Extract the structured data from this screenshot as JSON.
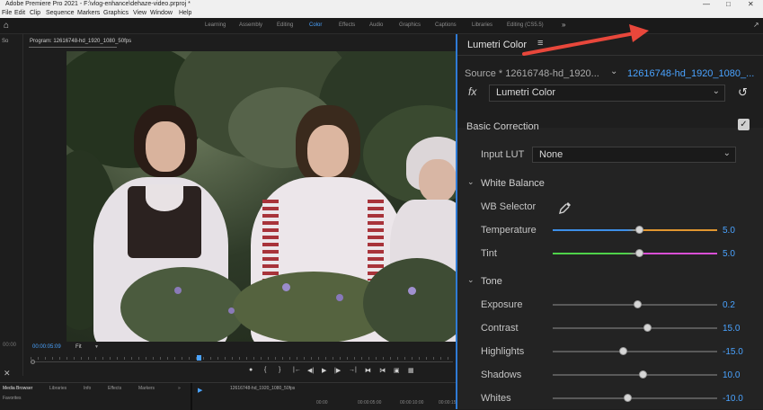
{
  "window": {
    "title": "Adobe Premiere Pro 2021 - F:\\vlog-enhance\\dehaze-video.prproj *",
    "controls": [
      "minimize",
      "maximize",
      "close"
    ]
  },
  "menu": [
    "File",
    "Edit",
    "Clip",
    "Sequence",
    "Markers",
    "Graphics",
    "View",
    "Window",
    "Help"
  ],
  "workspaces": [
    {
      "label": "Learning",
      "active": false
    },
    {
      "label": "Assembly",
      "active": false
    },
    {
      "label": "Editing",
      "active": false
    },
    {
      "label": "Color",
      "active": true
    },
    {
      "label": "Effects",
      "active": false
    },
    {
      "label": "Audio",
      "active": false
    },
    {
      "label": "Graphics",
      "active": false
    },
    {
      "label": "Captions",
      "active": false
    },
    {
      "label": "Libraries",
      "active": false
    },
    {
      "label": "Editing (CS5.5)",
      "active": false
    }
  ],
  "left_column": {
    "tab": "So",
    "timecode": "00:00",
    "wrench_glyph": "✕"
  },
  "program": {
    "title": "Program: 12616748-hd_1920_1080_50fps",
    "timecode": "00:00:05:09",
    "fit": "Fit",
    "transport": [
      "●",
      "{",
      "}",
      "|←",
      "◀|",
      "▶",
      "|▶",
      "→|",
      "⧓",
      "⧒",
      "▣",
      "▦"
    ]
  },
  "bottom": {
    "tabs": [
      {
        "label": "Media Browser",
        "active": true
      },
      {
        "label": "Libraries",
        "active": false
      },
      {
        "label": "Info",
        "active": false
      },
      {
        "label": "Effects",
        "active": false
      },
      {
        "label": "Markers",
        "active": false
      }
    ],
    "favorites": "Favorites",
    "sequence": "12616748-hd_1920_1080_50fps",
    "timecodes": [
      "00:00",
      "00:00:05:00",
      "00:00:10:00",
      "00:00:15:00"
    ],
    "more": "»"
  },
  "lumetri": {
    "title": "Lumetri Color",
    "menu_glyph": "≡",
    "source": "Source * 12616748-hd_1920...",
    "clip": "12616748-hd_1920_1080_...",
    "fx": "fx",
    "effect": "Lumetri Color",
    "basic_correction": "Basic Correction",
    "basic_correction_enabled": true,
    "input_lut_label": "Input LUT",
    "input_lut_value": "None",
    "white_balance": "White Balance",
    "wb_selector": "WB Selector",
    "tone": "Tone",
    "sliders": [
      {
        "label": "Temperature",
        "value": "5.0",
        "position": 0.53,
        "track": "temperature"
      },
      {
        "label": "Tint",
        "value": "5.0",
        "position": 0.53,
        "track": "tint"
      },
      {
        "label": "Exposure",
        "value": "0.2",
        "position": 0.52,
        "track": "gray"
      },
      {
        "label": "Contrast",
        "value": "15.0",
        "position": 0.58,
        "track": "gray"
      },
      {
        "label": "Highlights",
        "value": "-15.0",
        "position": 0.43,
        "track": "gray"
      },
      {
        "label": "Shadows",
        "value": "10.0",
        "position": 0.55,
        "track": "gray"
      },
      {
        "label": "Whites",
        "value": "-10.0",
        "position": 0.46,
        "track": "gray"
      }
    ]
  },
  "colors": {
    "accent": "#4aa3ff",
    "annotation_arrow": "#e8473b"
  }
}
